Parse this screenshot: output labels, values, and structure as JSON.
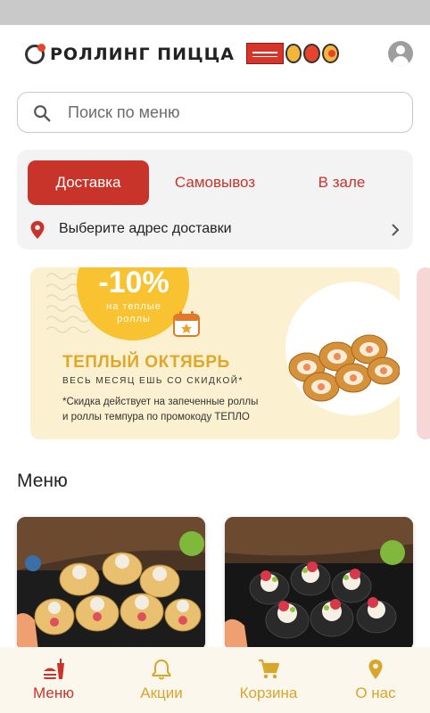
{
  "header": {
    "logo_text": "РОЛЛИНГ ПИЦЦА",
    "logo_icon": "rolling-pizza-logo",
    "profile_icon": "account-circle-icon"
  },
  "search": {
    "placeholder": "Поиск по меню",
    "icon": "search-icon"
  },
  "order_type": {
    "tabs": [
      {
        "label": "Доставка",
        "active": true
      },
      {
        "label": "Самовывоз",
        "active": false
      },
      {
        "label": "В зале",
        "active": false
      }
    ],
    "address_prompt": "Выберите адрес доставки"
  },
  "promo_banner": {
    "discount": "-10%",
    "discount_sub_1": "на теплые",
    "discount_sub_2": "роллы",
    "title": "ТЕПЛЫЙ ОКТЯБРЬ",
    "tagline": "ВЕСЬ МЕСЯЦ ЕШЬ СО СКИДКОЙ*",
    "note_line_1": "*Скидка действует на запеченные роллы",
    "note_line_2": "и роллы темпура по промокоду ТЕПЛО"
  },
  "menu_section": {
    "title": "Меню"
  },
  "bottom_nav": {
    "items": [
      {
        "label": "Меню",
        "icon": "fastfood-icon",
        "active": true
      },
      {
        "label": "Акции",
        "icon": "bell-icon",
        "active": false
      },
      {
        "label": "Корзина",
        "icon": "cart-icon",
        "active": false
      },
      {
        "label": "О нас",
        "icon": "location-pin-icon",
        "active": false
      }
    ]
  },
  "colors": {
    "accent": "#c8342a",
    "nav_inactive": "#d9a52a",
    "promo_yellow": "#f8c230"
  }
}
